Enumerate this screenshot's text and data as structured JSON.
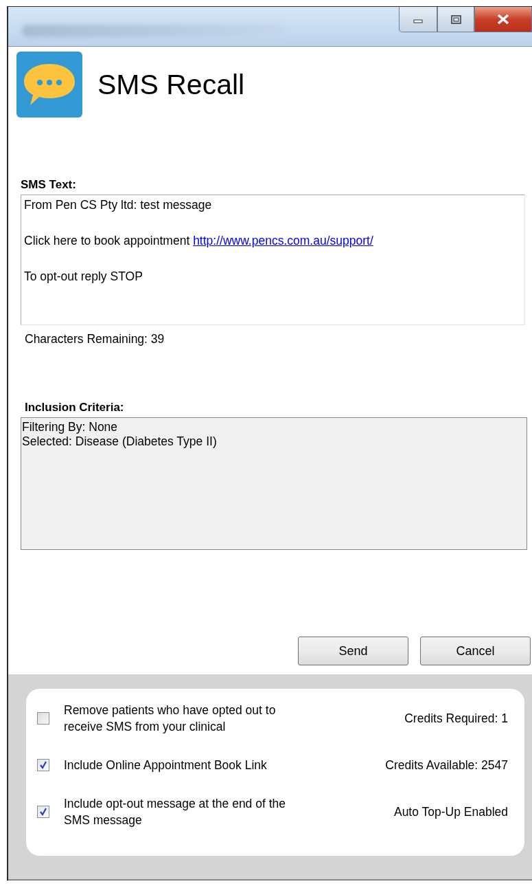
{
  "window": {
    "controls": [
      {
        "kind": "minimize"
      },
      {
        "kind": "maximize"
      },
      {
        "kind": "close"
      }
    ]
  },
  "header": {
    "title": "SMS Recall"
  },
  "sms_text": {
    "label": "SMS Text:",
    "lines": [
      {
        "text": "From Pen CS Pty ltd: test message"
      },
      {
        "text": "Click here to book appointment ",
        "link": "http://www.pencs.com.au/support/"
      },
      {
        "text": "To opt-out reply STOP"
      }
    ],
    "characters_remaining": "Characters Remaining: 39"
  },
  "inclusion_criteria": {
    "label": "Inclusion Criteria:",
    "lines": [
      "Filtering By: None",
      "Selected: Disease (Diabetes Type II)"
    ]
  },
  "buttons": [
    "Send",
    "Cancel"
  ],
  "options": [
    {
      "label": "Remove patients who have opted out to receive SMS from your clinical",
      "checked": false,
      "info": "Credits Required: 1"
    },
    {
      "label": "Include Online Appointment Book Link",
      "checked": true,
      "info": "Credits Available: 2547"
    },
    {
      "label": "Include opt-out message at the end of the SMS message",
      "checked": true,
      "info": "Auto Top-Up Enabled"
    }
  ]
}
